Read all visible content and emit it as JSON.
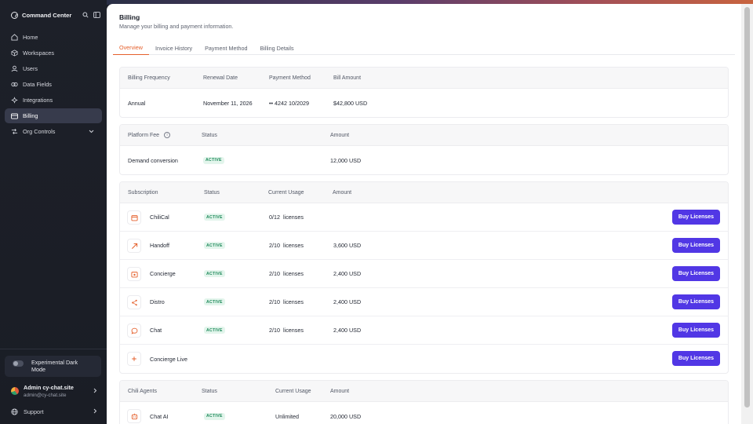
{
  "app": {
    "name": "Command Center"
  },
  "sidebar": {
    "items": [
      {
        "label": "Home",
        "icon": "home-icon"
      },
      {
        "label": "Workspaces",
        "icon": "cube-icon"
      },
      {
        "label": "Users",
        "icon": "user-icon"
      },
      {
        "label": "Data Fields",
        "icon": "data-icon"
      },
      {
        "label": "Integrations",
        "icon": "integrations-icon"
      },
      {
        "label": "Billing",
        "icon": "card-icon",
        "active": true
      },
      {
        "label": "Org Controls",
        "icon": "controls-icon"
      }
    ],
    "dark_mode_label": "Experimental Dark Mode",
    "user": {
      "name": "Admin cy-chat.site",
      "email": "admin@cy-chat.site"
    },
    "support_label": "Support"
  },
  "page": {
    "title": "Billing",
    "subtitle": "Manage your billing and payment information.",
    "tabs": [
      "Overview",
      "Invoice History",
      "Payment Method",
      "Billing Details"
    ],
    "active_tab": "Overview"
  },
  "billing_summary": {
    "headers": [
      "Billing Frequency",
      "Renewal Date",
      "Payment Method",
      "Bill Amount"
    ],
    "values": [
      "Annual",
      "November 11, 2026",
      "•• 4242 10/2029",
      "$42,800 USD"
    ]
  },
  "platform_fee": {
    "headers": [
      "Platform Fee",
      "Status",
      "Amount"
    ],
    "row": {
      "name": "Demand conversion",
      "status": "ACTIVE",
      "amount": "12,000 USD"
    }
  },
  "subscriptions": {
    "headers": [
      "Subscription",
      "Status",
      "Current Usage",
      "Amount"
    ],
    "buy_label": "Buy Licenses",
    "rows": [
      {
        "name": "ChiliCal",
        "status": "ACTIVE",
        "usage": "0/12",
        "unit": "licenses",
        "amount": ""
      },
      {
        "name": "Handoff",
        "status": "ACTIVE",
        "usage": "2/10",
        "unit": "licenses",
        "amount": "3,600 USD"
      },
      {
        "name": "Concierge",
        "status": "ACTIVE",
        "usage": "2/10",
        "unit": "licenses",
        "amount": "2,400 USD"
      },
      {
        "name": "Distro",
        "status": "ACTIVE",
        "usage": "2/10",
        "unit": "licenses",
        "amount": "2,400 USD"
      },
      {
        "name": "Chat",
        "status": "ACTIVE",
        "usage": "2/10",
        "unit": "licenses",
        "amount": "2,400 USD"
      },
      {
        "name": "Concierge Live",
        "status": "",
        "usage": "",
        "unit": "",
        "amount": ""
      }
    ]
  },
  "agents": {
    "headers": [
      "Chili Agents",
      "Status",
      "Current Usage",
      "Amount"
    ],
    "rows": [
      {
        "name": "Chat AI",
        "status": "ACTIVE",
        "usage": "Unlimited",
        "amount": "20,000 USD"
      }
    ]
  },
  "colors": {
    "accent": "#e5602c",
    "primary_button": "#5137e5",
    "sidebar_bg": "#1d2029",
    "active_badge": "#1e8a5a"
  }
}
